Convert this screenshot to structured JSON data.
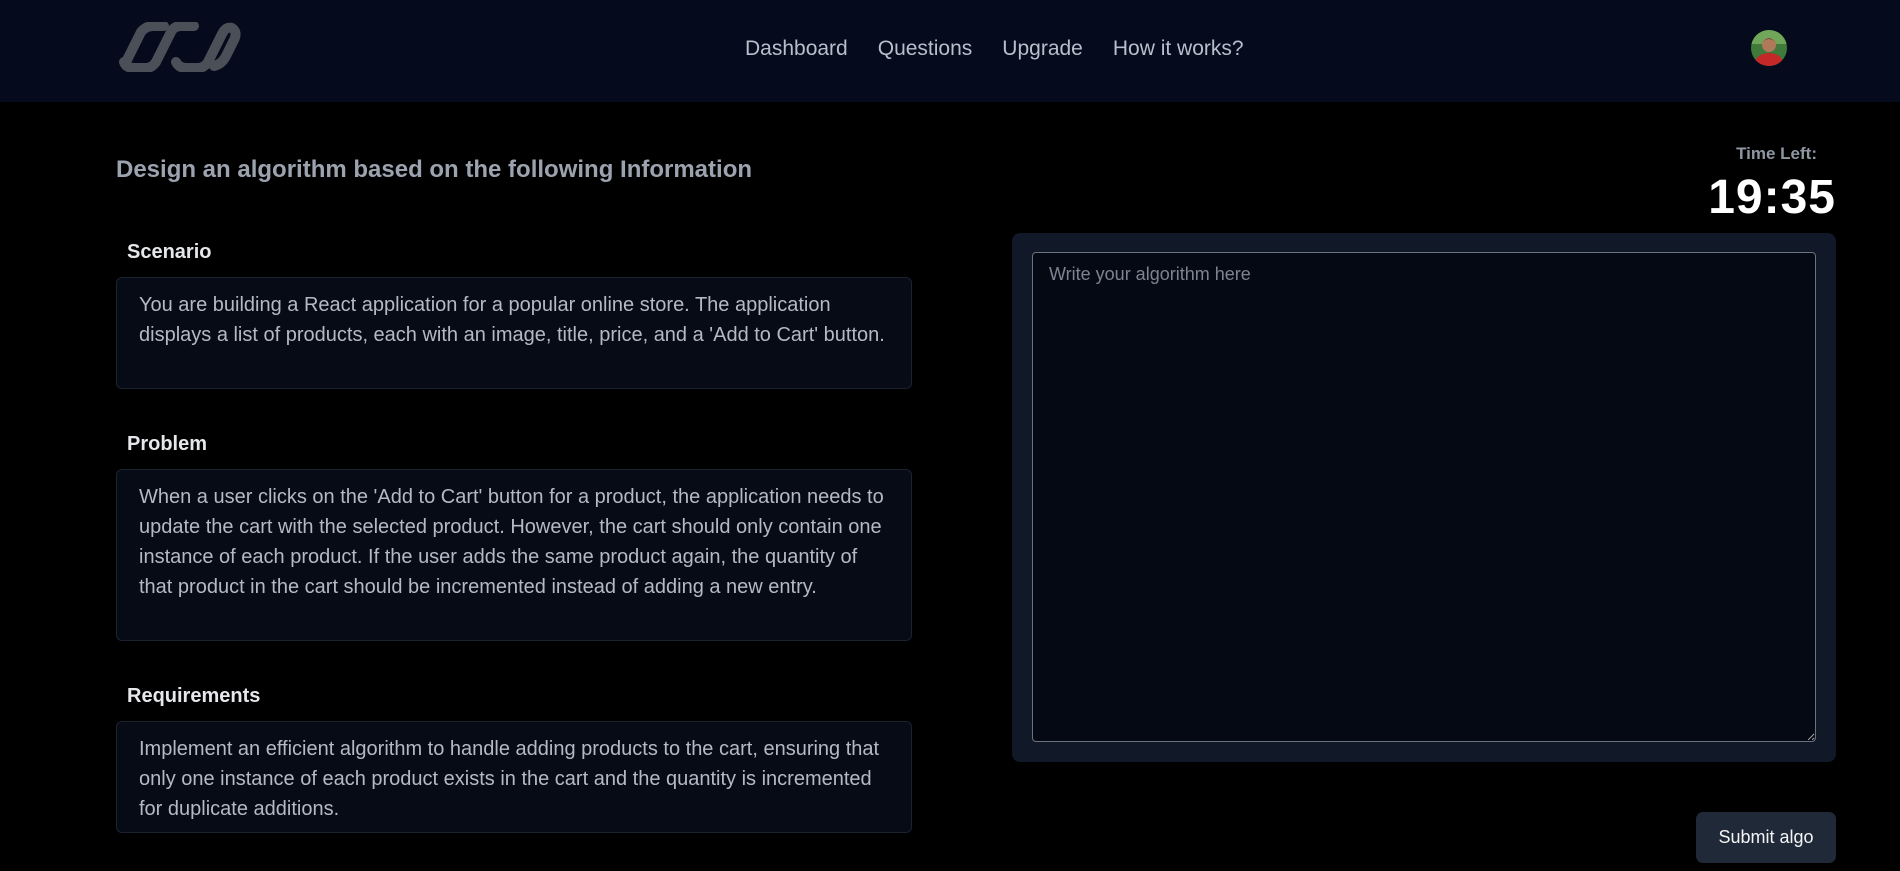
{
  "nav": {
    "logo_icon": "infinity-link-logo-icon",
    "links": [
      "Dashboard",
      "Questions",
      "Upgrade",
      "How it works?"
    ],
    "avatar_icon": "user-avatar-icon"
  },
  "main": {
    "title": "Design an algorithm based on the following Information",
    "sections": [
      {
        "label": "Scenario",
        "text": "You are building a React application for a popular online store. The application displays a list of products, each with an image, title, price, and a 'Add to Cart' button."
      },
      {
        "label": "Problem",
        "text": "When a user clicks on the 'Add to Cart' button for a product, the application needs to update the cart with the selected product. However, the cart should only contain one instance of each product. If the user adds the same product again, the quantity of that product in the cart should be incremented instead of adding a new entry."
      },
      {
        "label": "Requirements",
        "text": "Implement an efficient algorithm to handle adding products to the cart, ensuring that only one instance of each product exists in the cart and the quantity is incremented for duplicate additions."
      }
    ]
  },
  "timer": {
    "label": "Time Left:",
    "value": "19:35"
  },
  "editor": {
    "placeholder": "Write your algorithm here",
    "value": "",
    "submit_label": "Submit algo"
  },
  "colors": {
    "navbar_bg": "#050a1c",
    "page_bg": "#000000",
    "panel_bg": "#111827",
    "button_bg": "#1f2937"
  }
}
